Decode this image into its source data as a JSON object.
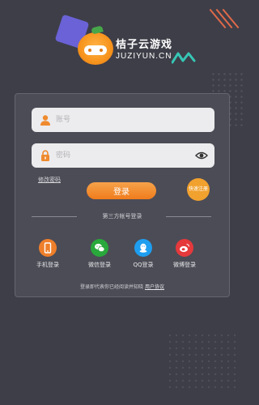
{
  "app": {
    "logo_title": "桔子云游戏",
    "logo_subtitle": "JUZIYUN.CN"
  },
  "login": {
    "account_placeholder": "账号",
    "password_placeholder": "密码",
    "forgot_password": "修改密码",
    "login_button": "登录",
    "quick_register": "快速注册"
  },
  "third_party": {
    "title": "第三方帐号登录",
    "options": [
      {
        "label": "手机登录",
        "icon": "phone-icon"
      },
      {
        "label": "微信登录",
        "icon": "wechat-icon"
      },
      {
        "label": "QQ登录",
        "icon": "qq-icon"
      },
      {
        "label": "微博登录",
        "icon": "weibo-icon"
      }
    ]
  },
  "agreement": {
    "text": "登录即代表你已经阅读并知晓",
    "link": "用户协议"
  },
  "colors": {
    "background": "#3e3e48",
    "card": "#4c4c56",
    "accent_orange": "#ef7c1c",
    "wechat_green": "#29a83b",
    "qq_blue": "#1e9ef0",
    "weibo_red": "#e5393c"
  }
}
